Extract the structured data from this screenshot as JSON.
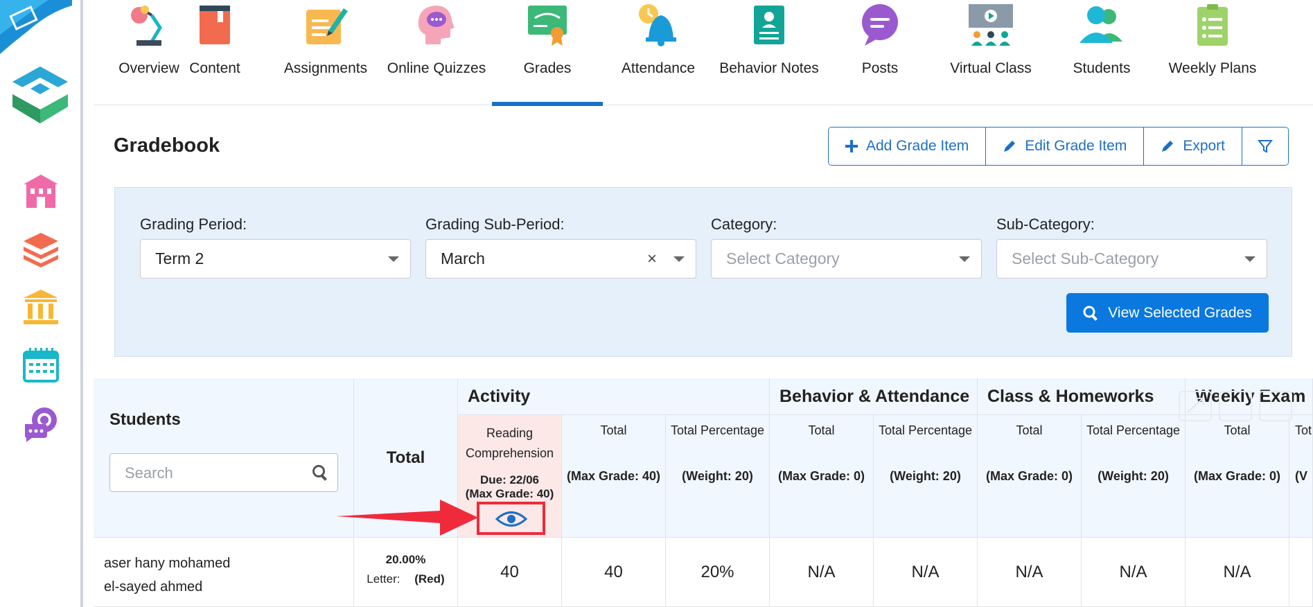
{
  "tabs": [
    {
      "label": "Overview"
    },
    {
      "label": "Content"
    },
    {
      "label": "Assignments"
    },
    {
      "label": "Online Quizzes"
    },
    {
      "label": "Grades"
    },
    {
      "label": "Attendance"
    },
    {
      "label": "Behavior Notes"
    },
    {
      "label": "Posts"
    },
    {
      "label": "Virtual Class"
    },
    {
      "label": "Students"
    },
    {
      "label": "Weekly Plans"
    }
  ],
  "active_tab": "Grades",
  "page": {
    "title": "Gradebook"
  },
  "toolbar": {
    "add_label": "Add Grade Item",
    "edit_label": "Edit Grade Item",
    "export_label": "Export"
  },
  "filters": {
    "grading_period": {
      "label": "Grading Period:",
      "value": "Term 2"
    },
    "grading_sub_period": {
      "label": "Grading Sub-Period:",
      "value": "March"
    },
    "category": {
      "label": "Category:",
      "placeholder": "Select Category"
    },
    "sub_category": {
      "label": "Sub-Category:",
      "placeholder": "Select Sub-Category"
    },
    "view_button": "View Selected Grades"
  },
  "table": {
    "students_header": "Students",
    "search_placeholder": "Search",
    "total_header": "Total",
    "groups": [
      "Activity",
      "Behavior & Attendance",
      "Class & Homeworks",
      "Weekly Exam"
    ],
    "activity_item": {
      "name_line1": "Reading",
      "name_line2": "Comprehension",
      "due": "Due: 22/06",
      "max": "(Max Grade: 40)"
    },
    "columns": [
      {
        "title": "Total",
        "sub": "(Max Grade: 40)"
      },
      {
        "title": "Total Percentage",
        "sub": "(Weight: 20)"
      },
      {
        "title": "Total",
        "sub": "(Max Grade: 0)"
      },
      {
        "title": "Total Percentage",
        "sub": "(Weight: 20)"
      },
      {
        "title": "Total",
        "sub": "(Max Grade: 0)"
      },
      {
        "title": "Total Percentage",
        "sub": "(Weight: 20)"
      },
      {
        "title": "Total",
        "sub": "(Max Grade: 0)"
      },
      {
        "title": "Tot",
        "sub": "(V"
      }
    ],
    "rows": [
      {
        "name_line1": "aser hany mohamed",
        "name_line2": "el-sayed ahmed",
        "total_percent": "20.00%",
        "letter_label": "Letter:",
        "letter_value": "(Red)",
        "values": [
          "40",
          "40",
          "20%",
          "N/A",
          "N/A",
          "N/A",
          "N/A",
          "N/A"
        ]
      }
    ]
  },
  "colors": {
    "primary": "#0a78df",
    "accent_blue": "#1672c6",
    "panel": "#e6f0fb",
    "highlight_cell": "#fde8e8",
    "annotation_red": "#ef2b3b"
  }
}
